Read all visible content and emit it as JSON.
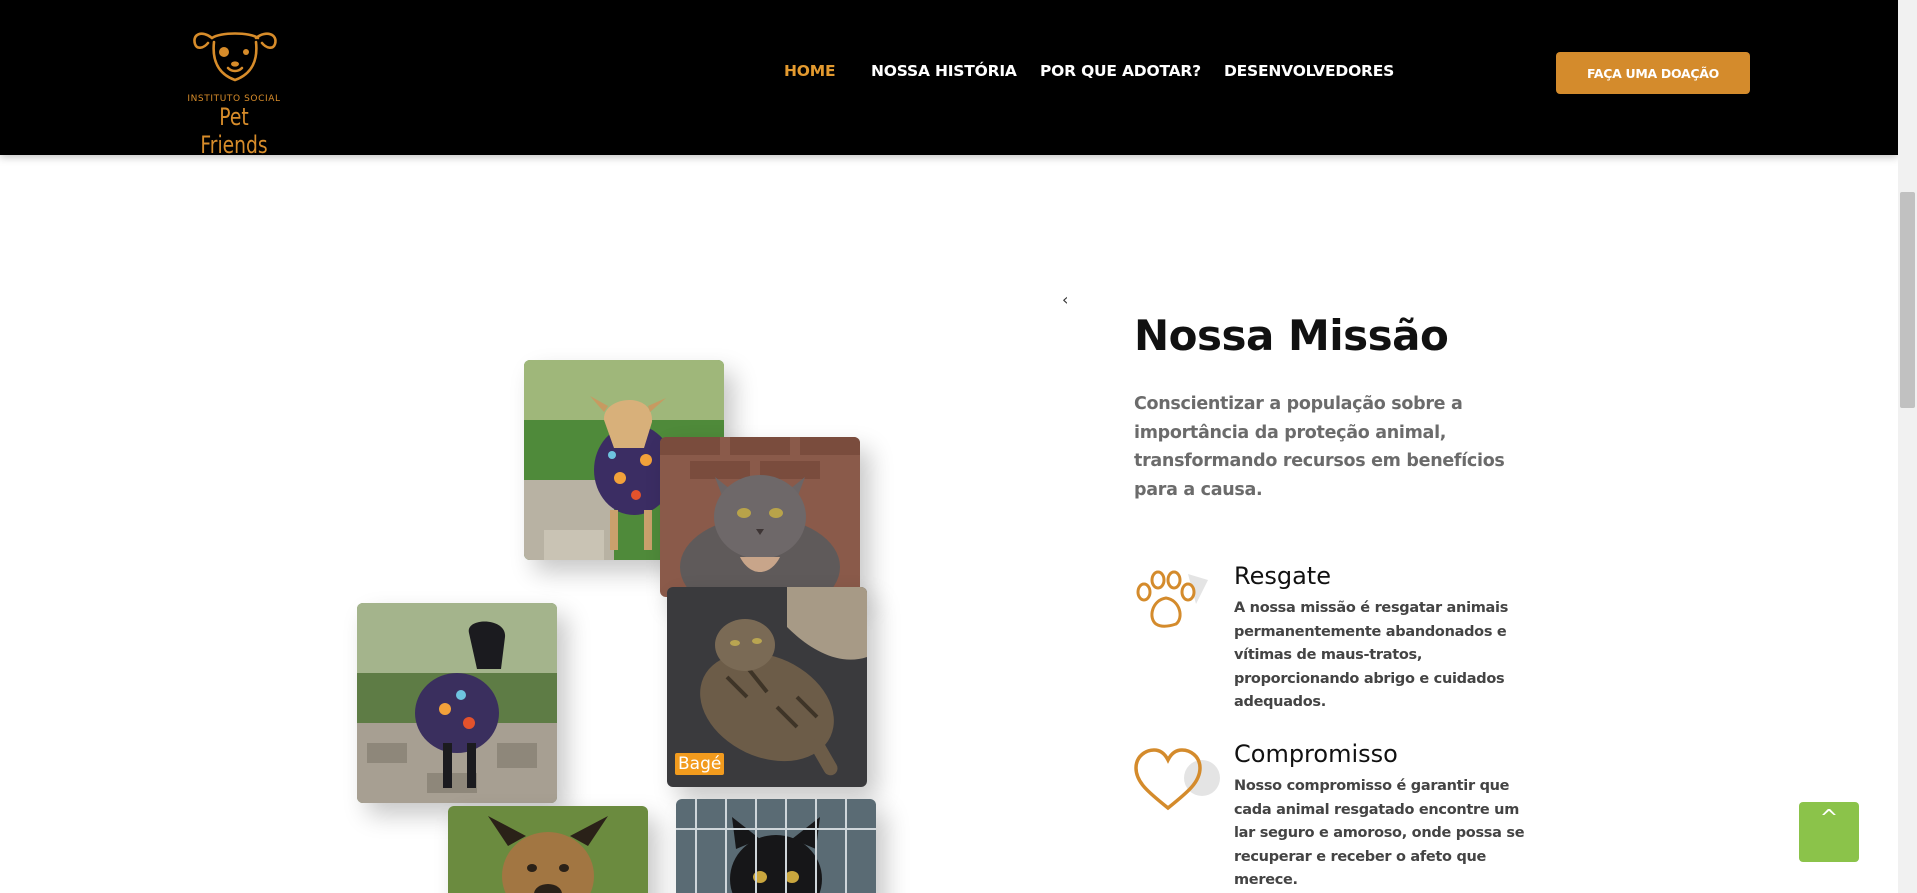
{
  "brand": {
    "tagline": "INSTITUTO SOCIAL",
    "name": "Pet Friends"
  },
  "nav": {
    "items": [
      {
        "label": "HOME",
        "active": true
      },
      {
        "label": "NOSSA HISTÓRIA",
        "active": false
      },
      {
        "label": "POR QUE ADOTAR?",
        "active": false
      },
      {
        "label": "DESENVOLVEDORES",
        "active": false
      }
    ],
    "donate_label": "FAÇA UMA DOAÇÃO"
  },
  "gallery": {
    "prev_arrow": "‹",
    "photos": [
      {
        "subject": "dog in colorful hoodie on grass"
      },
      {
        "subject": "grey cat"
      },
      {
        "subject": "tabby cat lying down",
        "caption": "Bagé"
      },
      {
        "subject": "black dog in colorful hoodie"
      },
      {
        "subject": "brown dog on grass"
      },
      {
        "subject": "black cat behind cage"
      }
    ]
  },
  "mission": {
    "title": "Nossa Missão",
    "description": "Conscientizar a população sobre a importância da proteção animal, transformando recursos em benefícios para a causa.",
    "features": [
      {
        "icon": "paw-icon",
        "title": "Resgate",
        "text": "A nossa missão é resgatar animais permanentemente abandonados e vítimas de maus-tratos, proporcionando abrigo e cuidados adequados."
      },
      {
        "icon": "heart-icon",
        "title": "Compromisso",
        "text": "Nosso compromisso é garantir que cada animal resgatado encontre um lar seguro e amoroso, onde possa se recuperar e receber o afeto que merece."
      }
    ]
  },
  "scroll_top_glyph": "^",
  "colors": {
    "accent": "#d48b2c",
    "nav_active": "#e39a2f",
    "header_bg": "#000000",
    "to_top_bg": "#8bc34a"
  }
}
